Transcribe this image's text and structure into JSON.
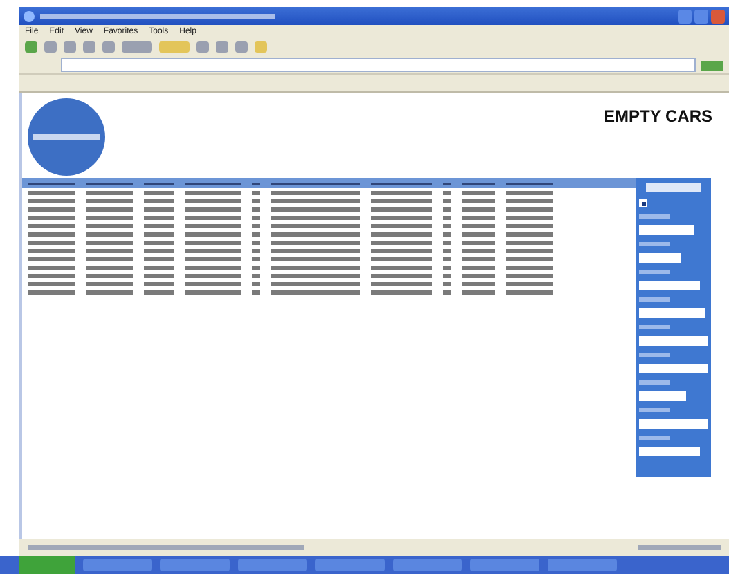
{
  "menu": [
    "File",
    "Edit",
    "View",
    "Favorites",
    "Tools",
    "Help"
  ],
  "page": {
    "heading": "EMPTY CARS"
  },
  "filter_panel": {
    "checkbox": {
      "checked": true
    }
  }
}
